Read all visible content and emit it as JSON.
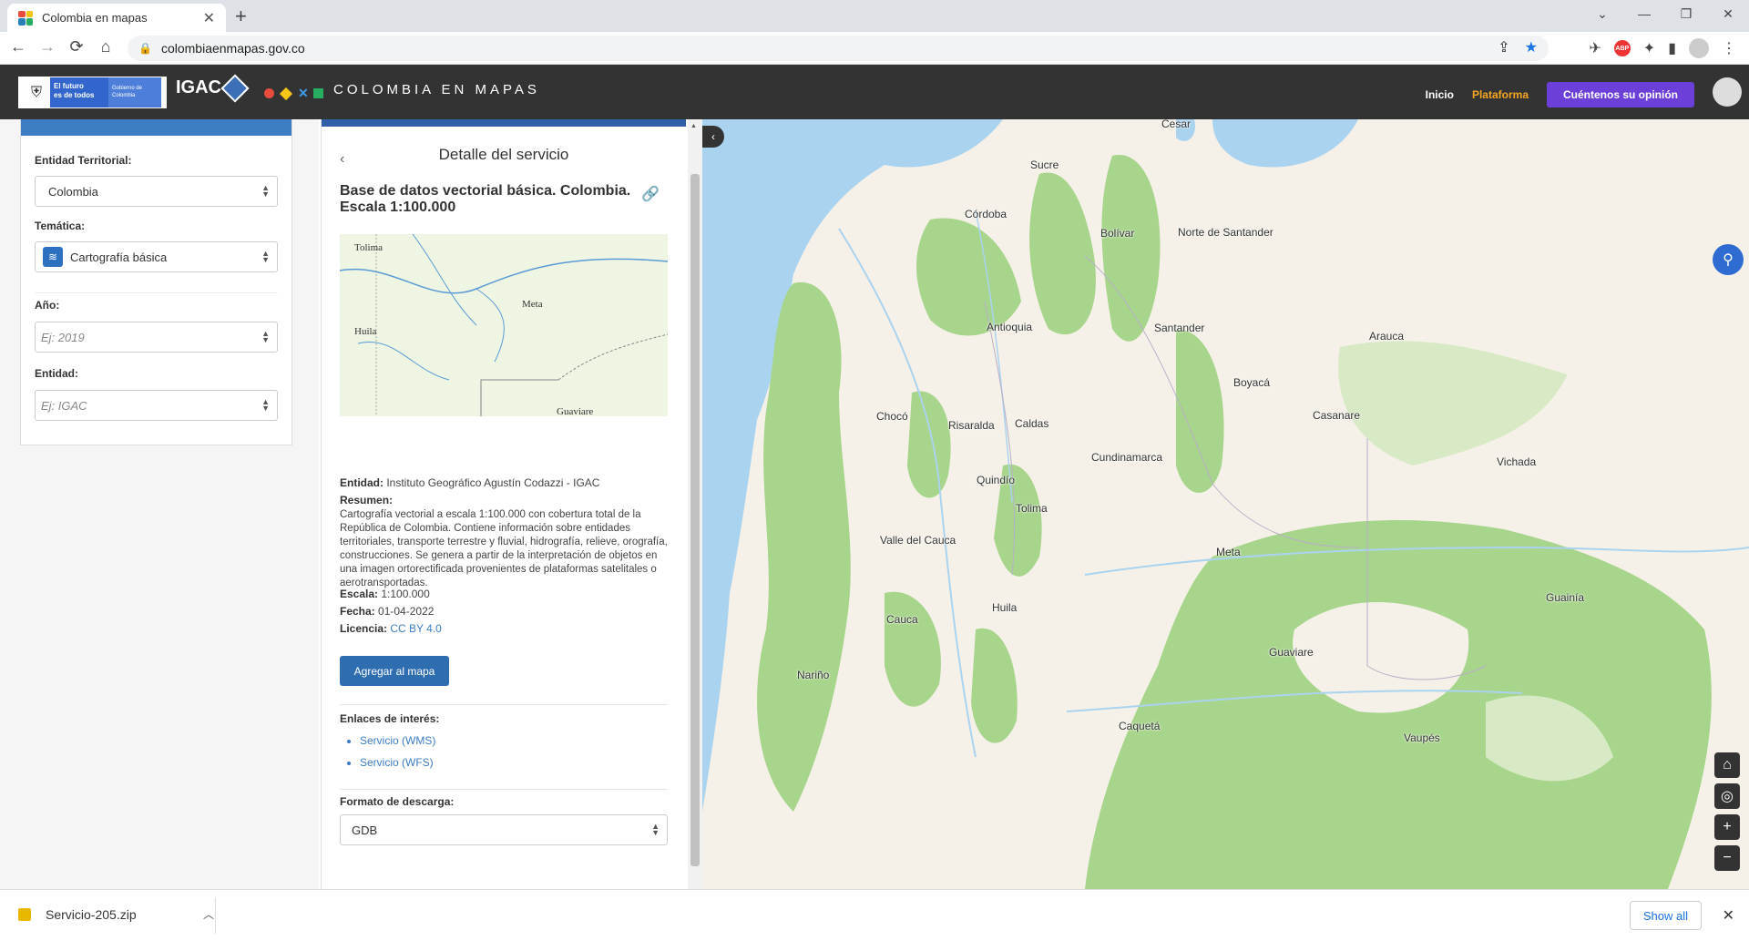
{
  "browser": {
    "tab_title": "Colombia en mapas",
    "url": "colombiaenmapas.gov.co",
    "new_tab": "+",
    "back": "←",
    "forward": "→",
    "reload": "⟳",
    "home": "⌂",
    "window_controls": [
      "⌄",
      "—",
      "❐",
      "✕"
    ],
    "abp_label": "ABP"
  },
  "header": {
    "gov_line1": "El futuro",
    "gov_line2": "es de todos",
    "gov_sub": "Gobierno de Colombia",
    "igac": "IGAC",
    "site_title": "COLOMBIA EN MAPAS",
    "nav_inicio": "Inicio",
    "nav_plataforma": "Plataforma",
    "opinion_button": "Cuéntenos su opinión"
  },
  "filters": {
    "entidad_territorial_label": "Entidad Territorial:",
    "entidad_territorial_value": "Colombia",
    "tematica_label": "Temática:",
    "tematica_value": "Cartografía básica",
    "anio_label": "Año:",
    "anio_placeholder": "Ej: 2019",
    "entidad_label": "Entidad:",
    "entidad_placeholder": "Ej: IGAC"
  },
  "detail": {
    "panel_title": "Detalle del servicio",
    "service_name": "Base de datos vectorial básica. Colombia. Escala 1:100.000",
    "thumb_labels": [
      "Tolima",
      "Meta",
      "Huila",
      "Guaviare"
    ],
    "entidad_label": "Entidad:",
    "entidad_value": "Instituto Geográfico Agustín Codazzi - IGAC",
    "resumen_label": "Resumen:",
    "resumen_value": "Cartografía vectorial a escala 1:100.000 con cobertura total de la República de Colombia. Contiene información sobre entidades territoriales, transporte terrestre y fluvial, hidrografía, relieve, orografía, construcciones. Se genera a partir de la interpretación de objetos en una imagen ortorectificada provenientes de plataformas satelitales o aerotransportadas.",
    "escala_label": "Escala:",
    "escala_value": "1:100.000",
    "fecha_label": "Fecha:",
    "fecha_value": "01-04-2022",
    "licencia_label": "Licencia:",
    "licencia_value": "CC BY 4.0",
    "add_button": "Agregar al mapa",
    "links_label": "Enlaces de interés:",
    "links": [
      "Servicio (WMS)",
      "Servicio (WFS)"
    ],
    "format_label": "Formato de descarga:",
    "format_value": "GDB"
  },
  "map": {
    "labels": [
      "Cesar",
      "Sucre",
      "Córdoba",
      "Bolívar",
      "Norte de Santander",
      "Antioquia",
      "Santander",
      "Arauca",
      "Boyacá",
      "Chocó",
      "Risaralda",
      "Caldas",
      "Casanare",
      "Cundinamarca",
      "Vichada",
      "Quindío",
      "Tolima",
      "Valle del Cauca",
      "Meta",
      "Huila",
      "Cauca",
      "Guainía",
      "Guaviare",
      "Nariño",
      "Caquetá",
      "Vaupés"
    ],
    "controls": [
      "⌂",
      "◎",
      "+",
      "−"
    ]
  },
  "downloads": {
    "file_name": "Servicio-205.zip",
    "show_all": "Show all"
  },
  "colors": {
    "header_bg": "#333333",
    "accent_blue": "#2e6db0",
    "plataforma": "#f5a623",
    "opinion_btn": "#6b3fd8",
    "map_land": "#f5f1e8",
    "map_forest": "#a8d58c",
    "map_water": "#aad3f0"
  }
}
